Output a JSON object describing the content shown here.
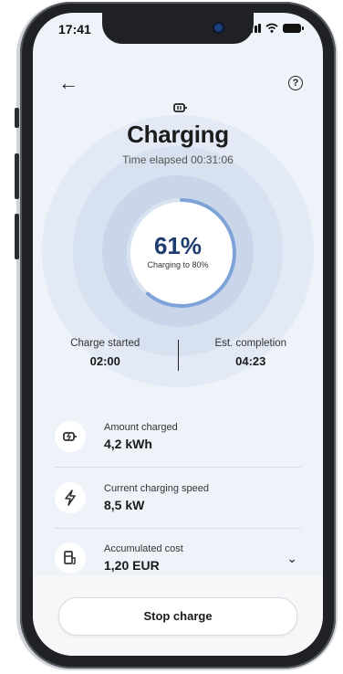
{
  "status_bar": {
    "time": "17:41"
  },
  "header": {
    "title": "Charging",
    "elapsed": "Time elapsed 00:31:06"
  },
  "gauge": {
    "percent": 61,
    "percent_label": "61%",
    "target_label": "Charging to 80%"
  },
  "times": {
    "start_label": "Charge started",
    "start_value": "02:00",
    "end_label": "Est. completion",
    "end_value": "04:23"
  },
  "details": [
    {
      "icon": "plug-icon",
      "label": "Amount charged",
      "value": "4,2 kWh"
    },
    {
      "icon": "lightning-icon",
      "label": "Current charging speed",
      "value": "8,5 kW"
    },
    {
      "icon": "fuel-station-icon",
      "label": "Accumulated cost",
      "value": "1,20 EUR"
    }
  ],
  "actions": {
    "stop_label": "Stop charge"
  },
  "colors": {
    "accent": "#7ea3d8",
    "title_blue": "#1f3c70"
  }
}
